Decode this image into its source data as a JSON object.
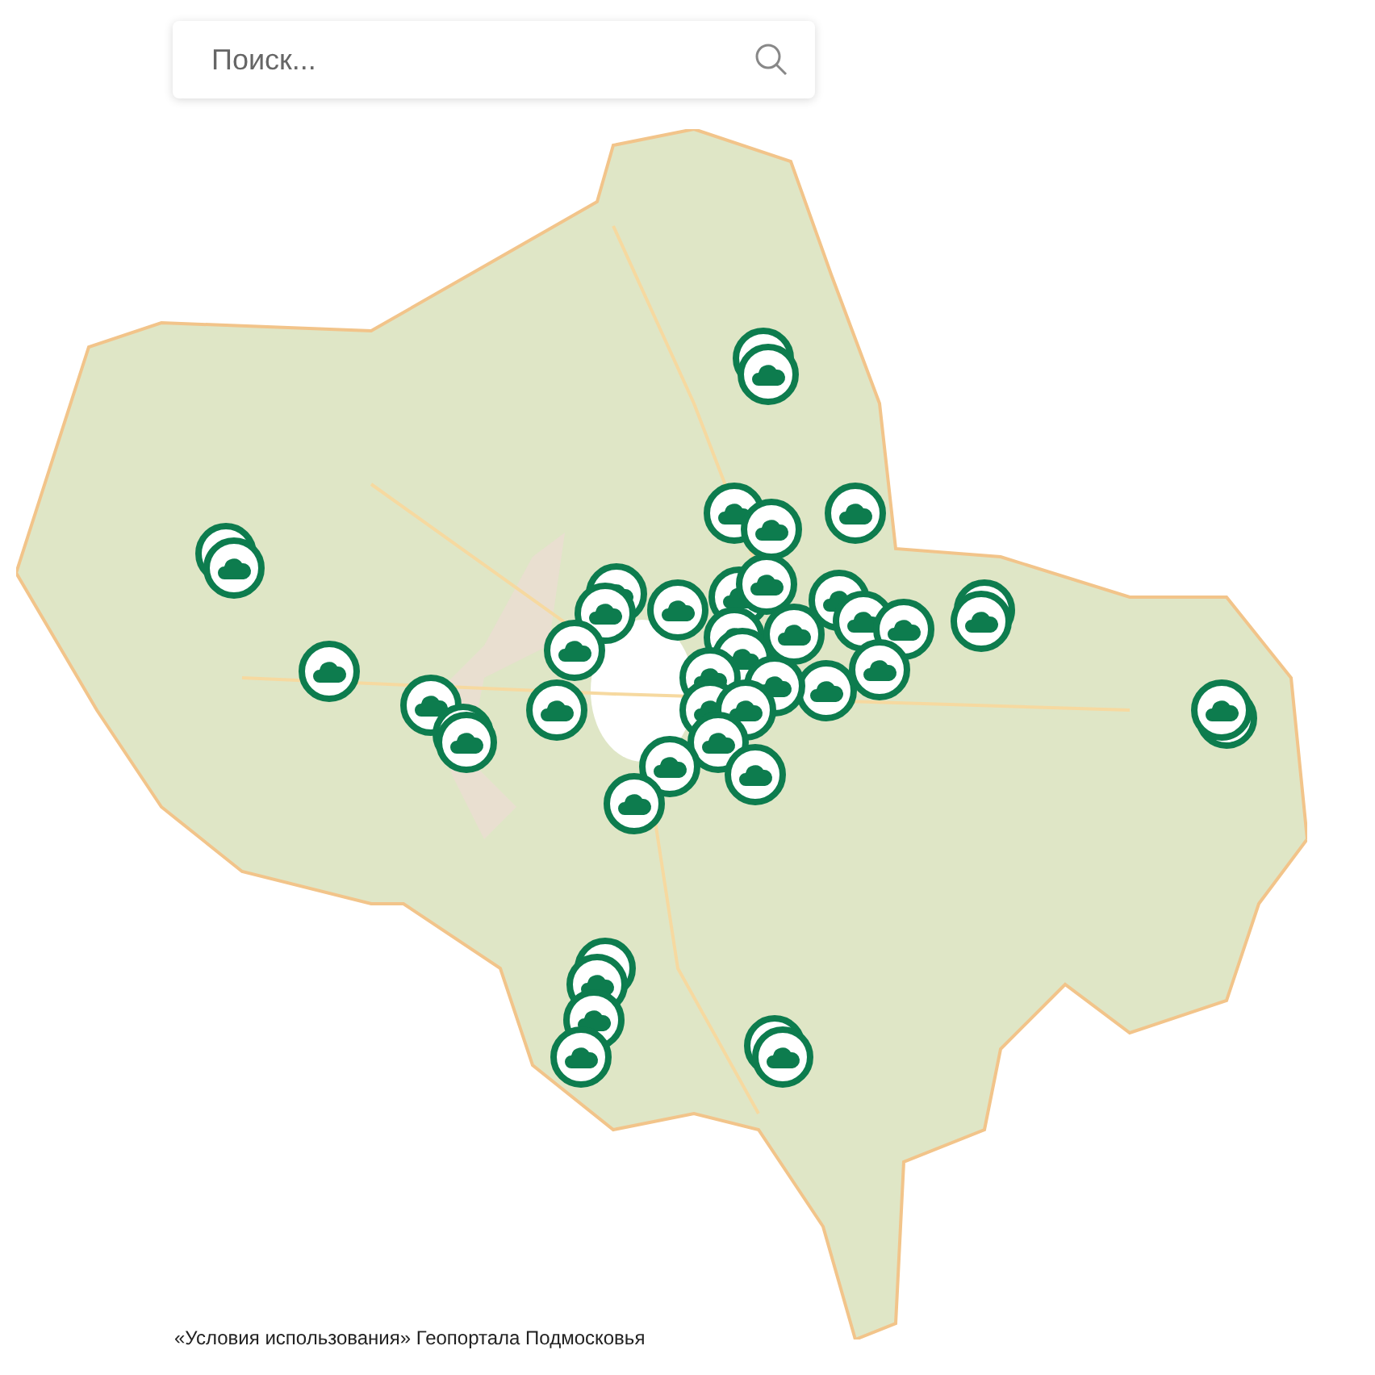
{
  "search": {
    "placeholder": "Поиск..."
  },
  "footer": {
    "link": "«Условия использования» Геопортала Подмосковья"
  }
}
